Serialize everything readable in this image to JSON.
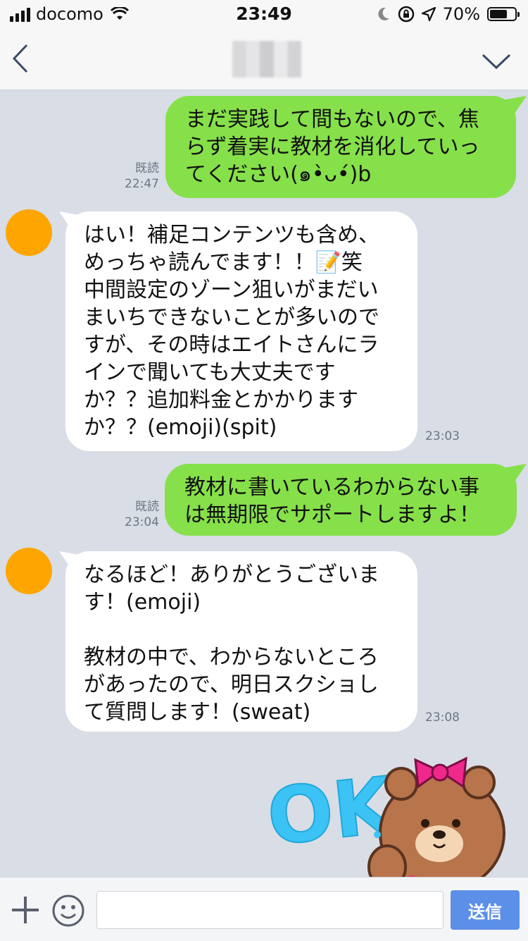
{
  "status_bar": {
    "carrier": "docomo",
    "time": "23:49",
    "battery": "70%",
    "battery_level": 0.7,
    "icons": [
      "signal-icon",
      "wifi-icon",
      "moon-icon",
      "rotation-lock-icon",
      "location-icon",
      "battery-icon"
    ]
  },
  "nav": {
    "back_icon": "chevron-left-icon",
    "menu_icon": "chevron-down-icon"
  },
  "messages": [
    {
      "side": "sent",
      "text": "まだ実践して間もないので、焦\nらず着実に教材を消化していっ\nてください(๑•̀ᴗ•́)b",
      "read": "既読",
      "time": "22:47"
    },
    {
      "side": "received",
      "text": "はい！補足コンテンツも含め、\nめっちゃ読んでます！！📝笑\n中間設定のゾーン狙いがまだい\nまいちできないことが多いので\nすが、その時はエイトさんにラ\nインで聞いても大丈夫です\nか？？追加料金とかかります\nか？？(emoji)(spit)",
      "time": "23:03"
    },
    {
      "side": "sent",
      "text": "教材に書いているわからない事\nは無期限でサポートしますよ！",
      "read": "既読",
      "time": "23:04"
    },
    {
      "side": "received",
      "text": "なるほど！ありがとうございま\nす！(emoji)\n\n教材の中で、わからないところ\nがあったので、明日スクショし\nて質問します！(sweat)",
      "time": "23:08"
    }
  ],
  "sticker": {
    "text": "OK",
    "colors": {
      "text": "#3cc3f5",
      "bear": "#b8744a",
      "bow": "#f0288c"
    }
  },
  "input_bar": {
    "placeholder": "",
    "send_label": "送信",
    "plus_icon": "plus-icon",
    "emoji_icon": "smiley-icon"
  },
  "colors": {
    "background": "#d9dde5",
    "sent_bubble": "#86e04a",
    "received_bubble": "#ffffff",
    "avatar": "#ffa500",
    "send_button": "#5b8fe8"
  }
}
